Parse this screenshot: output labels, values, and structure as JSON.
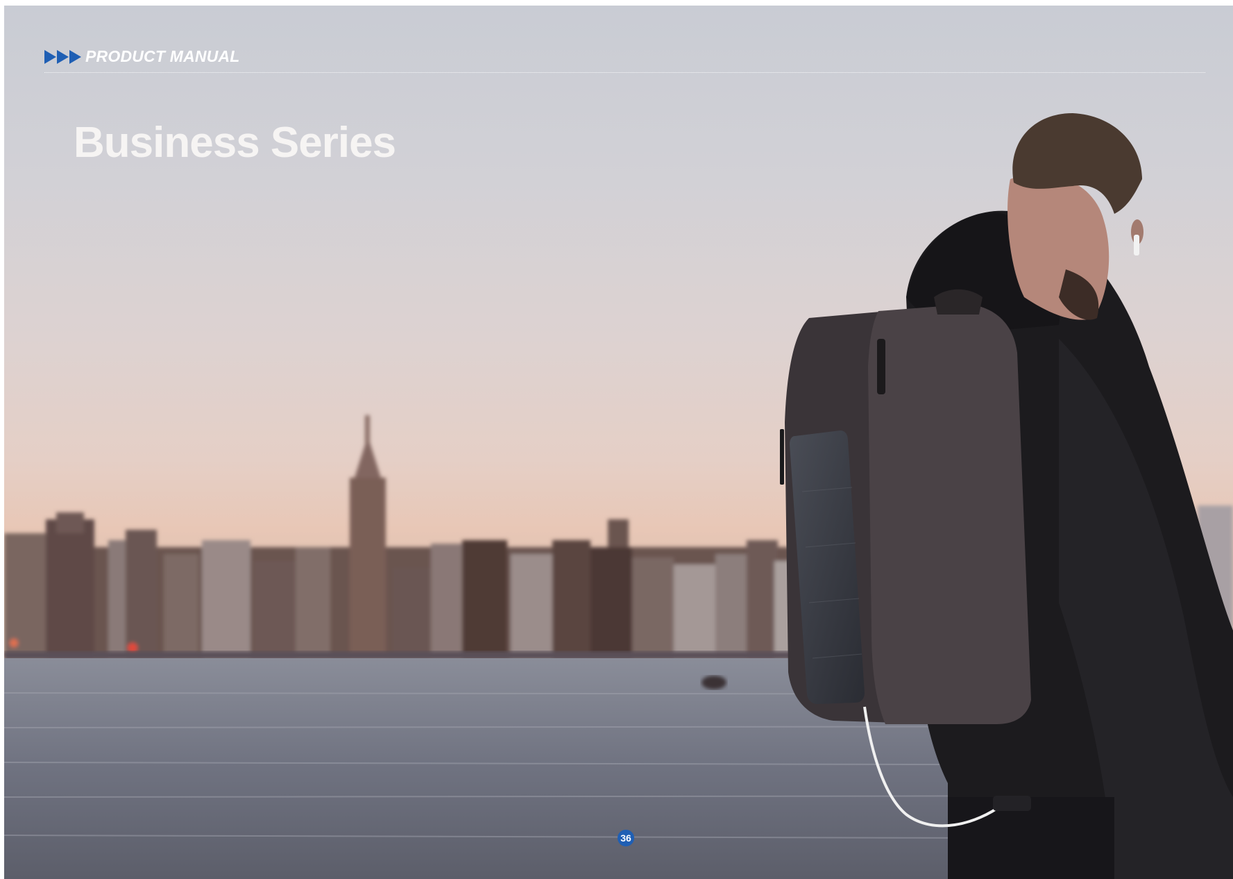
{
  "header": {
    "section_label": "PRODUCT MANUAL",
    "accent_color": "#1f5fb4",
    "icon": "triple-arrow-icon"
  },
  "title": "Business Series",
  "page_number": "36",
  "photo": {
    "icon": "backpack-photo"
  }
}
